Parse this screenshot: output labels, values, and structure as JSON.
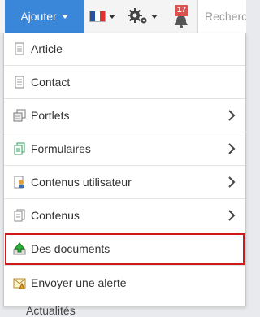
{
  "toolbar": {
    "add_label": "Ajouter",
    "notification_count": "17",
    "search_placeholder": "Recherche"
  },
  "menu": {
    "items": [
      {
        "label": "Article",
        "icon": "document-icon",
        "submenu": false
      },
      {
        "label": "Contact",
        "icon": "document-icon",
        "submenu": false
      },
      {
        "label": "Portlets",
        "icon": "portlet-icon",
        "submenu": true
      },
      {
        "label": "Formulaires",
        "icon": "forms-icon",
        "submenu": true
      },
      {
        "label": "Contenus utilisateur",
        "icon": "user-content-icon",
        "submenu": true
      },
      {
        "label": "Contenus",
        "icon": "contents-icon",
        "submenu": true
      },
      {
        "label": "Des documents",
        "icon": "upload-icon",
        "submenu": false,
        "highlighted": true
      },
      {
        "label": "Envoyer une alerte",
        "icon": "alert-mail-icon",
        "submenu": false
      }
    ]
  },
  "background": {
    "partial_text": "Actualités"
  },
  "colors": {
    "primary": "#3a86d9",
    "badge": "#d9534f",
    "highlight": "#d0191b"
  }
}
